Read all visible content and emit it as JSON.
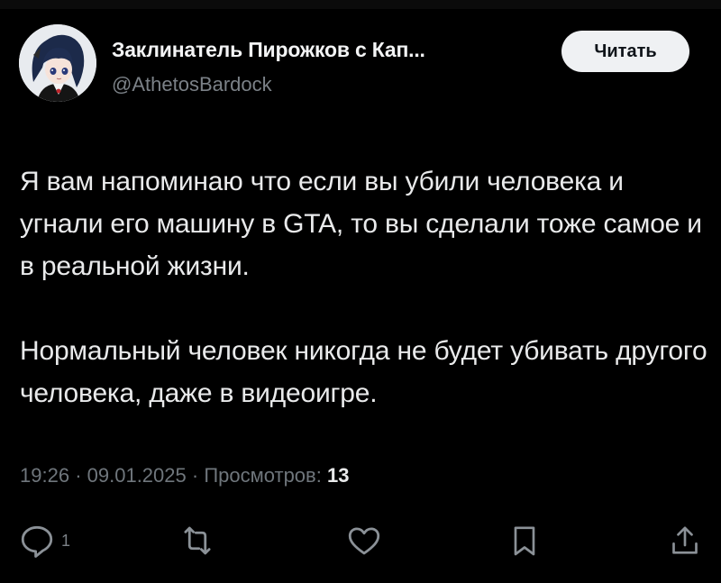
{
  "author": {
    "name": "Заклинатель Пирожков с Кап...",
    "handle": "@AthetosBardock"
  },
  "follow_button": {
    "label": "Читать"
  },
  "tweet": {
    "paragraphs": [
      "Я вам напоминаю что если вы убили человека и угнали его машину в GTA, то вы сделали тоже самое и в реальной жизни.",
      "Нормальный человек никогда не будет убивать другого человека, даже в видеоигре."
    ]
  },
  "meta": {
    "time": "19:26",
    "separator": "·",
    "date": "09.01.2025",
    "views_label": "Просмотров:",
    "views_count": "13"
  },
  "actions": {
    "reply": {
      "icon": "reply-icon",
      "count": "1"
    },
    "retweet": {
      "icon": "retweet-icon"
    },
    "like": {
      "icon": "heart-icon"
    },
    "bookmark": {
      "icon": "bookmark-icon"
    },
    "share": {
      "icon": "share-icon"
    }
  },
  "colors": {
    "background": "#000000",
    "text": "#e7e9ea",
    "secondary": "#71767b",
    "button_bg": "#eff1f3"
  }
}
